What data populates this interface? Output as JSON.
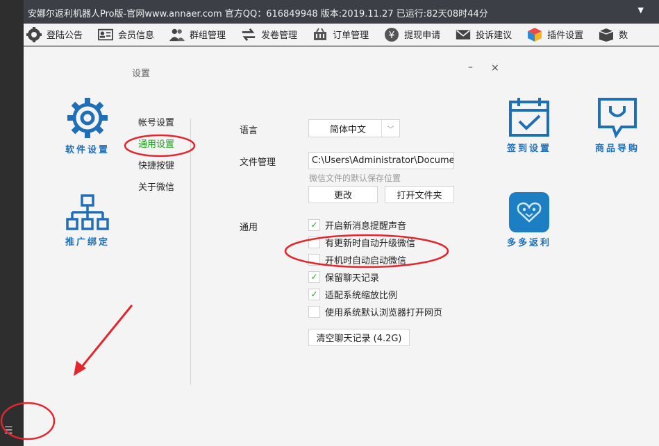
{
  "titlebar": {
    "text": "安娜尔返利机器人Pro版-官网www.annaer.com 官方QQ：616849948 版本:2019.11.27    已运行:82天08时44分",
    "dropdown": "▼"
  },
  "toolbar": {
    "items": [
      {
        "label": "登陆公告",
        "icon": "gear-notice-icon"
      },
      {
        "label": "会员信息",
        "icon": "id-card-icon"
      },
      {
        "label": "群组管理",
        "icon": "group-icon"
      },
      {
        "label": "发卷管理",
        "icon": "transfer-icon"
      },
      {
        "label": "订单管理",
        "icon": "cart-icon"
      },
      {
        "label": "提现申请",
        "icon": "yen-icon"
      },
      {
        "label": "投诉建议",
        "icon": "mail-icon"
      },
      {
        "label": "插件设置",
        "icon": "cube-icon"
      },
      {
        "label": "数",
        "icon": "box-icon"
      }
    ]
  },
  "window": {
    "title": "设置",
    "minimize": "–",
    "close": "×"
  },
  "left_apps": [
    {
      "label": "软件设置",
      "icon": "gear-icon"
    },
    {
      "label": "推广绑定",
      "icon": "org-chart-icon"
    }
  ],
  "right_apps": [
    {
      "label": "签到设置",
      "icon": "calendar-check-icon"
    },
    {
      "label": "商品导购",
      "icon": "chat-bag-icon"
    },
    {
      "label": "多多返利",
      "icon": "pinduoduo-icon"
    }
  ],
  "nav": {
    "items": [
      "帐号设置",
      "通用设置",
      "快捷按键",
      "关于微信"
    ],
    "active_index": 1
  },
  "settings": {
    "language": {
      "label": "语言",
      "value": "简体中文"
    },
    "file_mgmt": {
      "label": "文件管理",
      "path": "C:\\Users\\Administrator\\Documents",
      "hint": "微信文件的默认保存位置",
      "change_button": "更改",
      "open_folder_button": "打开文件夹"
    },
    "general": {
      "label": "通用",
      "options": [
        {
          "label": "开启新消息提醒声音",
          "checked": true
        },
        {
          "label": "有更新时自动升级微信",
          "checked": false
        },
        {
          "label": "开机时自动启动微信",
          "checked": false
        },
        {
          "label": "保留聊天记录",
          "checked": true
        },
        {
          "label": "适配系统缩放比例",
          "checked": true
        },
        {
          "label": "使用系统默认浏览器打开网页",
          "checked": false
        }
      ],
      "clear_button": "清空聊天记录 (4.2G)"
    }
  },
  "taskbar": {
    "menu_glyph": "☰"
  },
  "colors": {
    "accent_blue": "#1e6fb8",
    "active_green": "#1ca11c",
    "annotation_red": "#e3262d",
    "titlebar_bg": "#3c3f45"
  }
}
